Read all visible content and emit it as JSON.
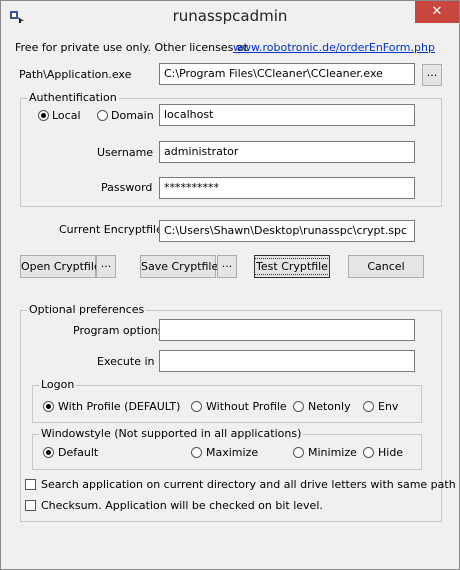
{
  "window": {
    "title": "runasspcadmin",
    "close_glyph": "✕"
  },
  "license": {
    "text": "Free for private use only. Other licenses at",
    "link": "www.robotronic.de/orderEnForm.php"
  },
  "path": {
    "label": "Path\\Application.exe",
    "value": "C:\\Program Files\\CCleaner\\CCleaner.exe",
    "browse": "..."
  },
  "auth": {
    "title": "Authentification",
    "local_label": "Local",
    "domain_label": "Domain",
    "selected": "Local",
    "domain_value": "localhost",
    "username_label": "Username",
    "username_value": "administrator",
    "password_label": "Password",
    "password_value": "**********"
  },
  "cryptfile": {
    "label": "Current Encryptfile",
    "value": "C:\\Users\\Shawn\\Desktop\\runasspc\\crypt.spc"
  },
  "buttons": {
    "open": "Open Cryptfile",
    "open_more": "...",
    "save": "Save Cryptfile",
    "save_more": "...",
    "test": "Test Cryptfile",
    "cancel": "Cancel"
  },
  "optional": {
    "title": "Optional preferences",
    "program_options_label": "Program options",
    "program_options_value": "",
    "execute_in_label": "Execute in",
    "execute_in_value": ""
  },
  "logon": {
    "title": "Logon",
    "options": [
      "With Profile (DEFAULT)",
      "Without Profile",
      "Netonly",
      "Env"
    ],
    "selected": "With Profile (DEFAULT)"
  },
  "windowstyle": {
    "title": "Windowstyle (Not supported in all applications)",
    "options": [
      "Default",
      "Maximize",
      "Minimize",
      "Hide"
    ],
    "selected": "Default"
  },
  "checks": {
    "search": {
      "label": "Search application on current directory and all drive letters with same path",
      "checked": false
    },
    "checksum": {
      "label": "Checksum. Application will be checked on bit level.",
      "checked": false
    }
  }
}
